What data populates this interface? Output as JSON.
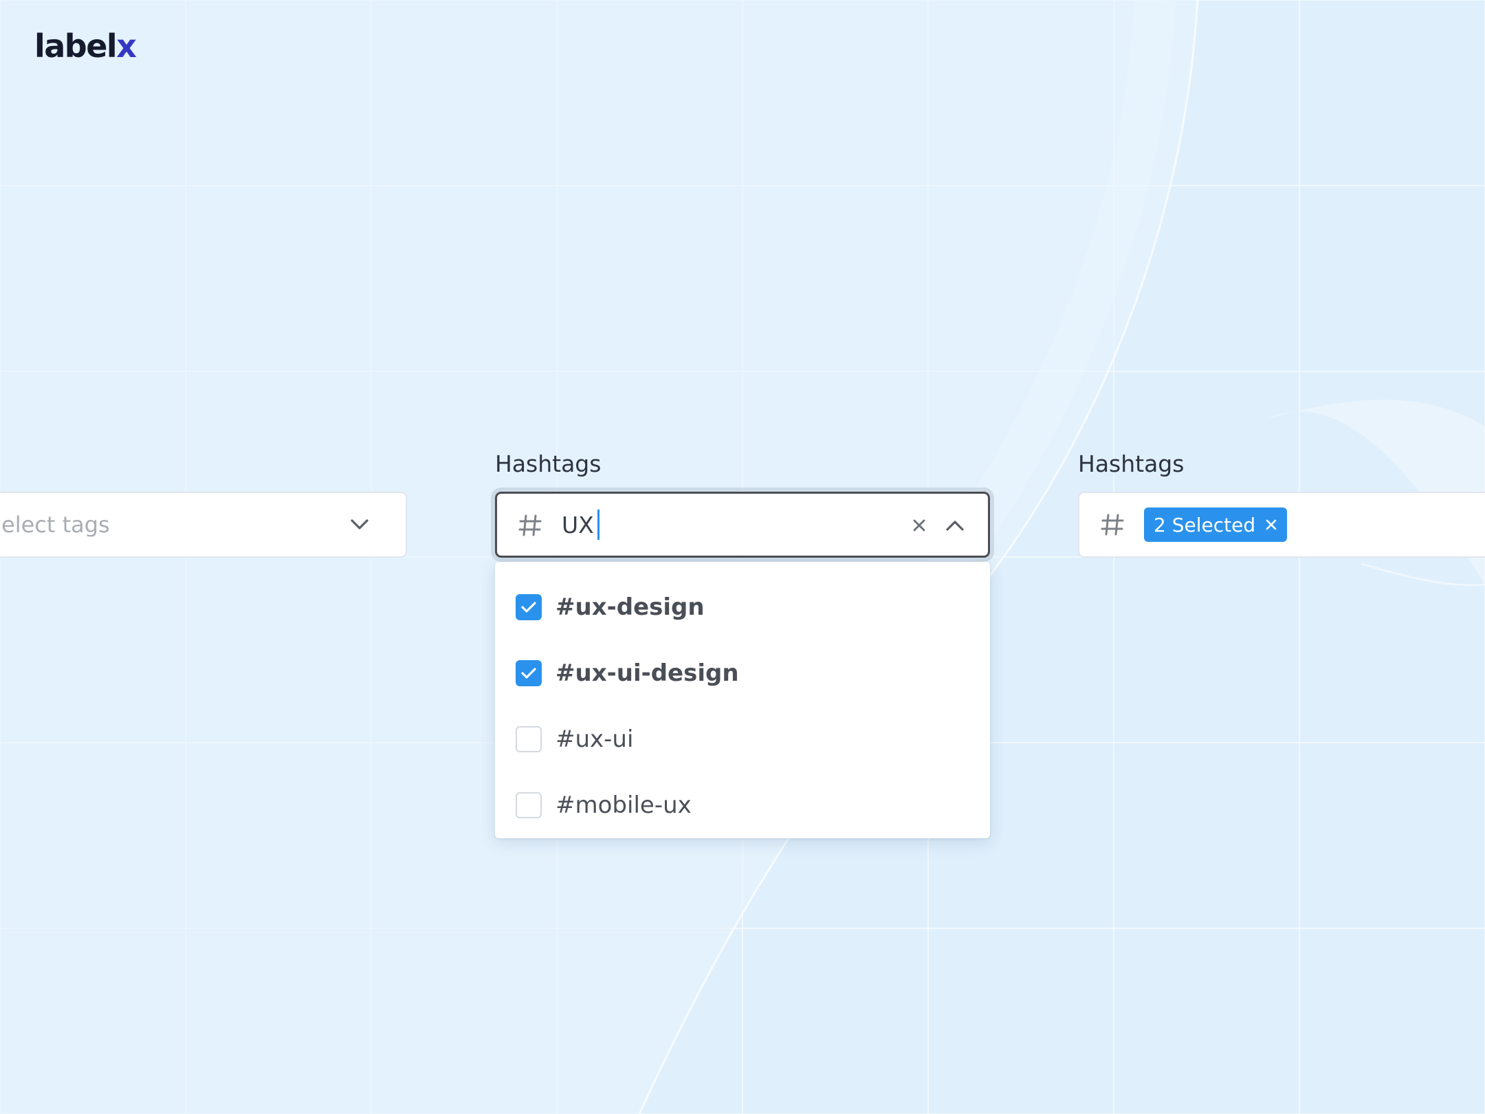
{
  "brand": {
    "logo_main": "label",
    "logo_accent": "x"
  },
  "left_field": {
    "placeholder": "Select tags",
    "visible_text": "elect tags",
    "icon": "chevron-down-icon"
  },
  "center_field": {
    "label": "Hashtags",
    "prefix_icon": "hash-icon",
    "value": "UX",
    "clear_icon": "close-icon",
    "toggle_icon": "chevron-up-icon",
    "options": [
      {
        "label": "#ux-design",
        "checked": true
      },
      {
        "label": "#ux-ui-design",
        "checked": true
      },
      {
        "label": "#ux-ui",
        "checked": false
      },
      {
        "label": "#mobile-ux",
        "checked": false
      }
    ]
  },
  "right_field": {
    "label": "Hashtags",
    "prefix_icon": "hash-icon",
    "chip_label": "2 Selected",
    "chip_remove_icon": "close-icon"
  },
  "colors": {
    "background": "#dfeffc",
    "accent": "#2a92ec",
    "logo_accent": "#3437c2",
    "text_dark": "#2c323f"
  }
}
